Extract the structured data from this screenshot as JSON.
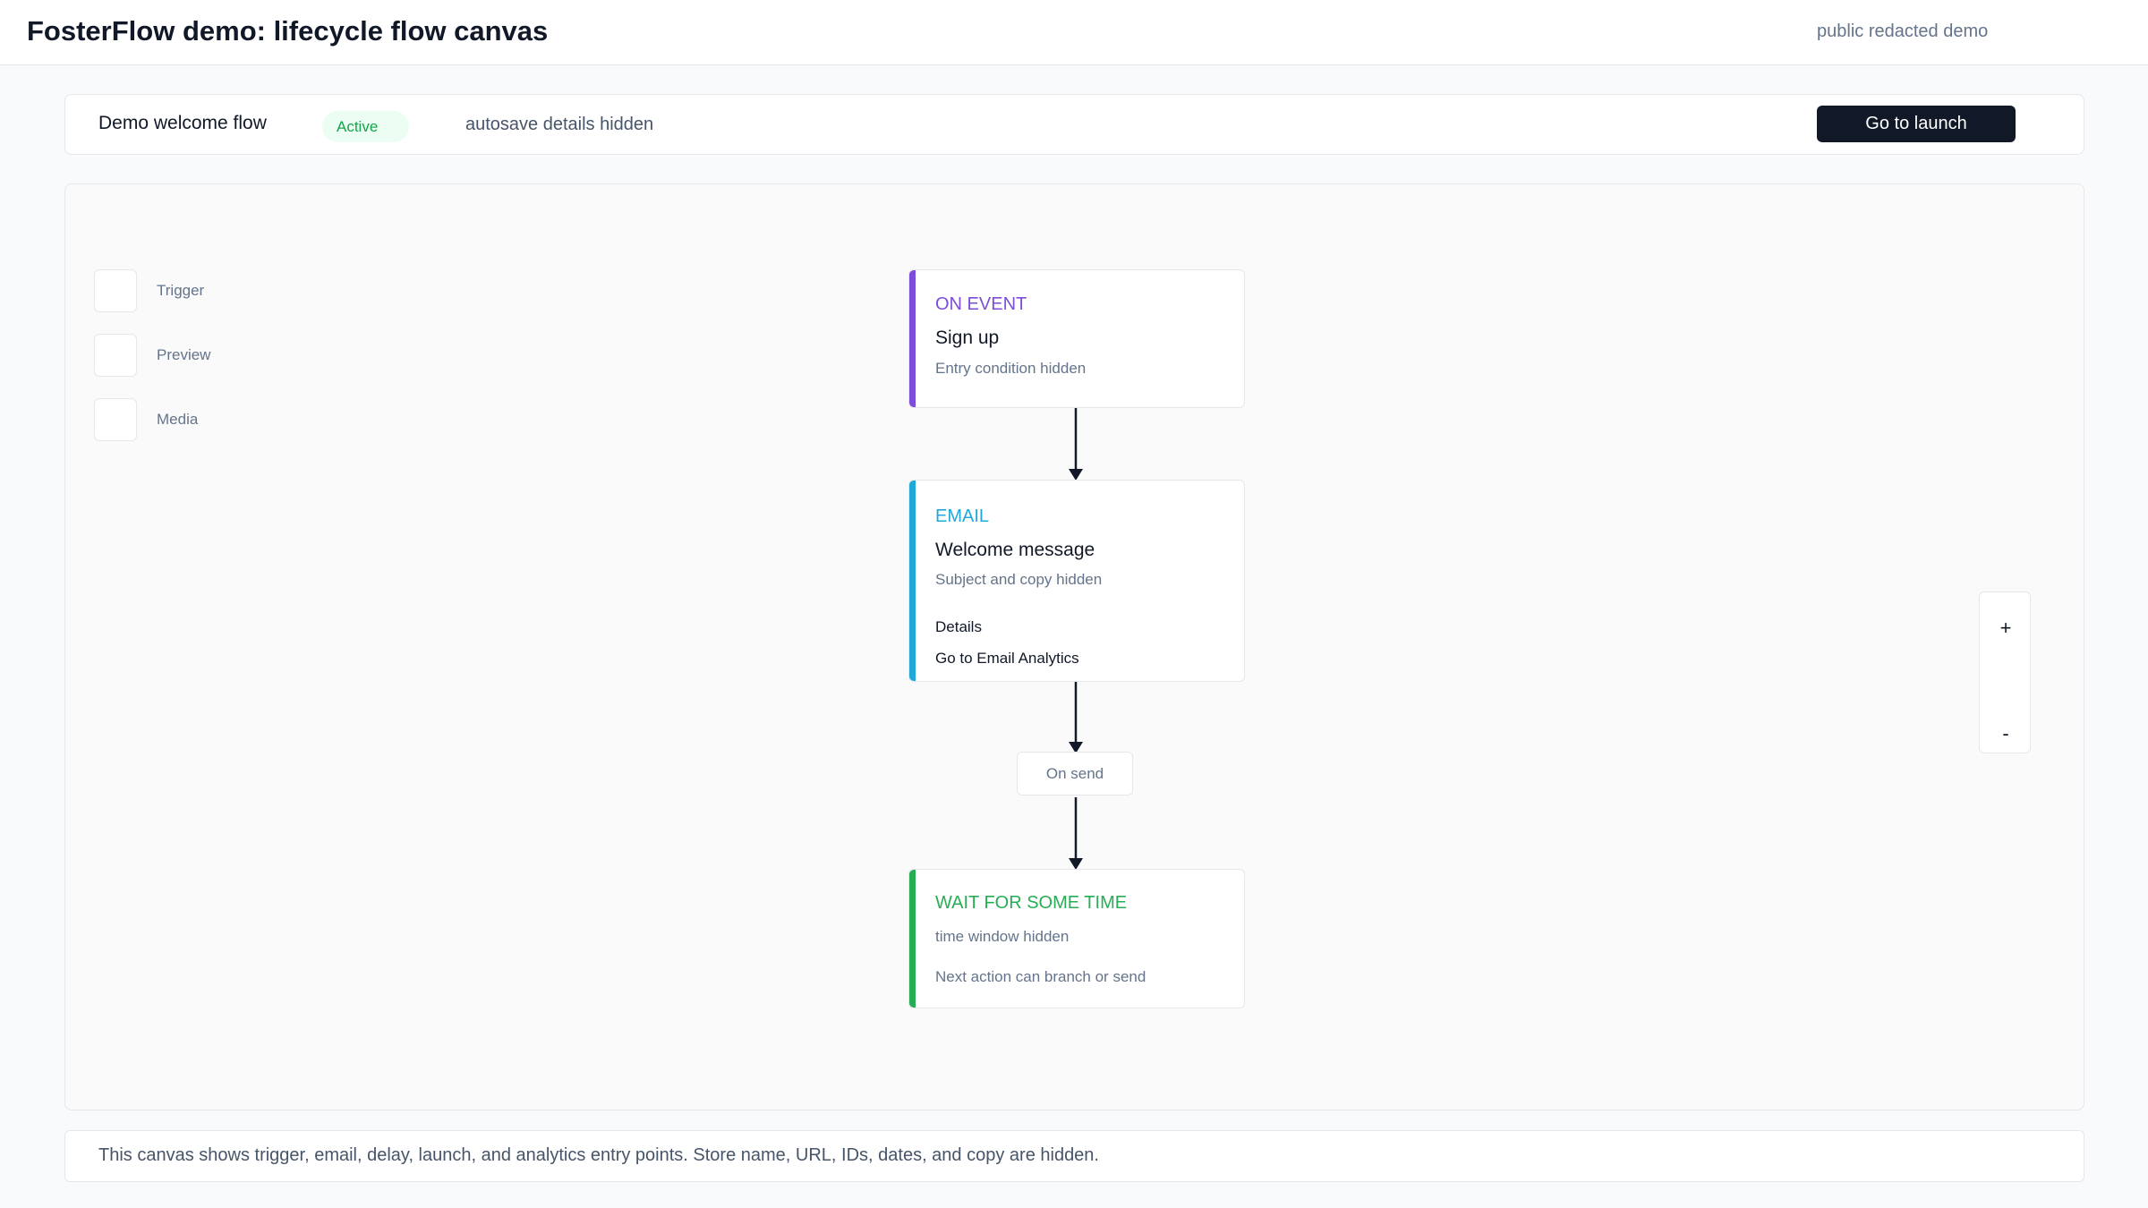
{
  "header": {
    "title": "FosterFlow demo: lifecycle flow canvas",
    "note": "public redacted demo"
  },
  "flowbar": {
    "name": "Demo welcome flow",
    "status": "Active",
    "autosave": "autosave details hidden",
    "launch_label": "Go to launch"
  },
  "palette": {
    "items": [
      {
        "label": "Trigger"
      },
      {
        "label": "Preview"
      },
      {
        "label": "Media"
      }
    ]
  },
  "nodes": {
    "trigger": {
      "kind": "ON EVENT",
      "title": "Sign up",
      "sub": "Entry condition hidden",
      "accent": "#7c4dda"
    },
    "email": {
      "kind": "EMAIL",
      "title": "Welcome message",
      "sub": "Subject and copy hidden",
      "details": "Details",
      "analytics": "Go to Email Analytics",
      "accent": "#1fa9d8"
    },
    "edge_label": "On send",
    "wait": {
      "kind": "WAIT FOR SOME TIME",
      "sub": "time window hidden",
      "next": "Next action can branch or send",
      "accent": "#27ae55"
    }
  },
  "zoom": {
    "in_label": "+",
    "out_label": "-"
  },
  "footer": {
    "text": "This canvas shows trigger, email, delay, launch, and analytics entry points. Store name, URL, IDs, dates, and copy are hidden."
  }
}
